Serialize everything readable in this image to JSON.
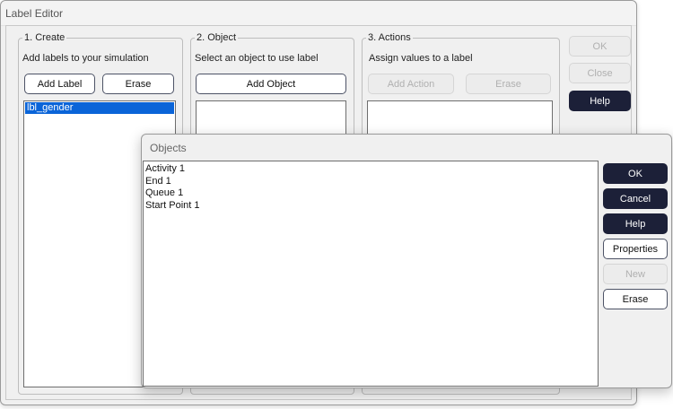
{
  "window": {
    "title": "Label Editor"
  },
  "create": {
    "legend": "1. Create",
    "hint": "Add labels to your simulation",
    "add_label": "Add Label",
    "erase": "Erase",
    "labels": [
      "lbl_gender"
    ],
    "selected_index": 0
  },
  "object": {
    "legend": "2. Object",
    "hint": "Select an object to use label",
    "add_object": "Add Object"
  },
  "actions": {
    "legend": "3. Actions",
    "hint": "Assign values to a label",
    "add_action": "Add Action",
    "erase": "Erase"
  },
  "side_buttons": {
    "ok": "OK",
    "close": "Close",
    "help": "Help"
  },
  "objects_dialog": {
    "title": "Objects",
    "items": [
      "Activity 1",
      "End 1",
      "Queue 1",
      "Start Point 1"
    ],
    "buttons": {
      "ok": "OK",
      "cancel": "Cancel",
      "help": "Help",
      "properties": "Properties",
      "new": "New",
      "erase": "Erase"
    }
  },
  "colors": {
    "dark_button": "#1c2038",
    "selection": "#0a64d8",
    "window_bg": "#f0f0f0"
  }
}
